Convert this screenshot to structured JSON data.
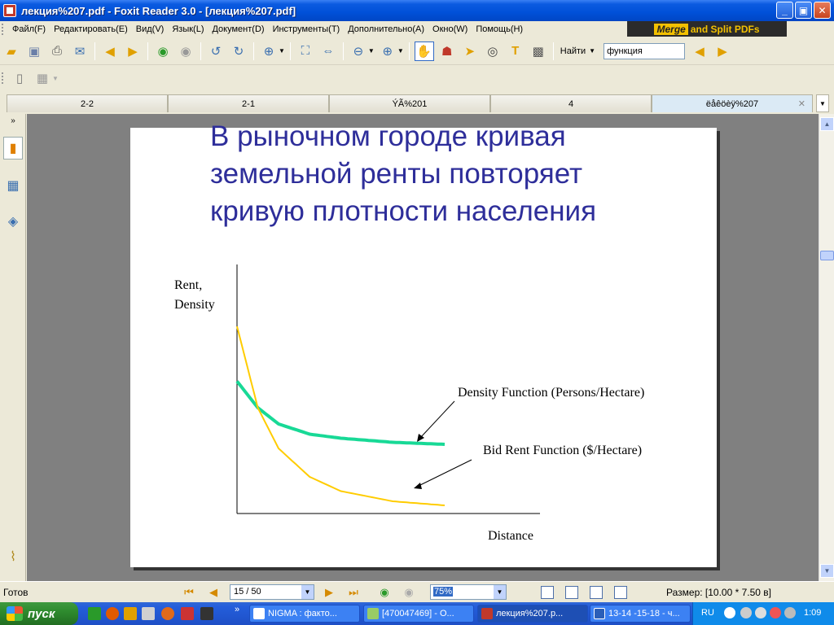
{
  "window": {
    "title": "лекция%207.pdf - Foxit Reader 3.0 - [лекция%207.pdf]",
    "min_label": "_",
    "max_label": "▣",
    "close_label": "✕"
  },
  "menu": [
    "Файл(F)",
    "Редактировать(E)",
    "Вид(V)",
    "Язык(L)",
    "Документ(D)",
    "Инструменты(T)",
    "Дополнительно(A)",
    "Окно(W)",
    "Помощь(H)"
  ],
  "banner": {
    "merge": "Merge",
    "rest": "and Split PDFs"
  },
  "toolbar": {
    "find_label": "Найти",
    "find_value": "функция"
  },
  "tabs": [
    {
      "label": "2-2"
    },
    {
      "label": "2-1"
    },
    {
      "label": "ÝÃ%201"
    },
    {
      "label": "4"
    },
    {
      "label": "ëåêöèÿ%207",
      "close": "✕"
    }
  ],
  "slide": {
    "title_lines": [
      "В рыночном городе кривая",
      "земельной ренты повторяет",
      "кривую плотности населения"
    ],
    "colors": {
      "title": "#2e2e9a",
      "density": "#18d996",
      "bid_rent": "#ffcc00"
    }
  },
  "chart_data": {
    "type": "line",
    "ylabel_line1": "Rent,",
    "ylabel_line2": "Density",
    "xlabel": "Distance",
    "series": [
      {
        "name": "Density Function (Persons/Hectare)",
        "x": [
          0,
          0.1,
          0.2,
          0.35,
          0.5,
          0.75,
          1.0
        ],
        "y": [
          0.65,
          0.52,
          0.44,
          0.39,
          0.37,
          0.35,
          0.34
        ]
      },
      {
        "name": "Bid Rent Function ($/Hectare)",
        "x": [
          0,
          0.1,
          0.2,
          0.35,
          0.5,
          0.75,
          1.0
        ],
        "y": [
          0.92,
          0.52,
          0.32,
          0.18,
          0.11,
          0.06,
          0.04
        ]
      }
    ],
    "annotations": [
      "Density Function (Persons/Hectare)",
      "Bid Rent Function ($/Hectare)"
    ]
  },
  "status": {
    "ready": "Готов",
    "page": "15 / 50",
    "zoom": "75%",
    "size": "Размер: [10.00 * 7.50 в]"
  },
  "taskbar": {
    "start": "пуск",
    "chevron": "»",
    "tasks": [
      "NIGMA : факто...",
      "[470047469] - О...",
      "лекция%207.p...",
      "13-14 -15-18 - ч..."
    ],
    "lang": "RU",
    "clock": "1:09"
  }
}
